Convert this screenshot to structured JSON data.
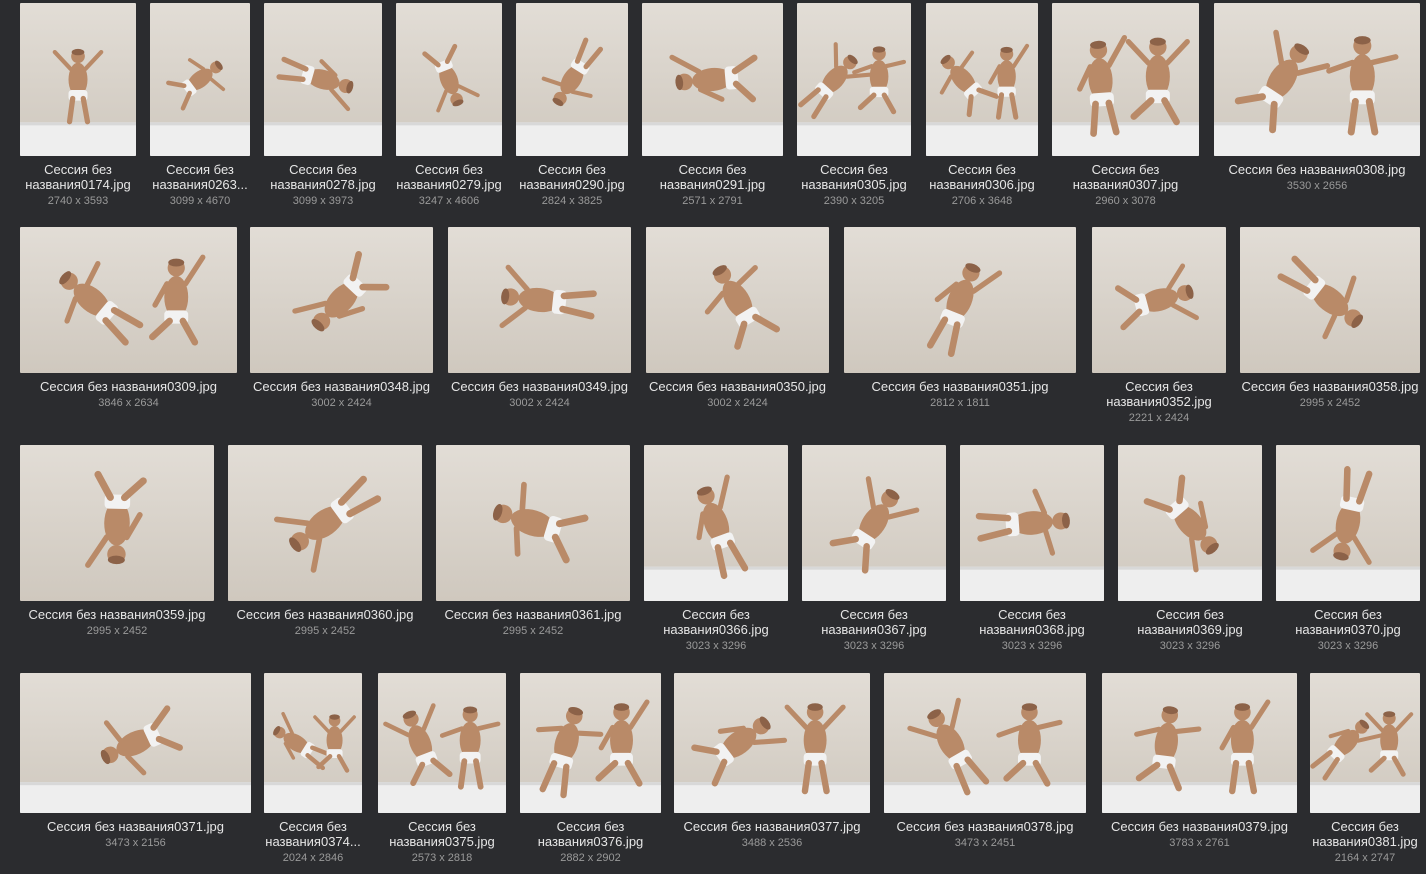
{
  "gallery": {
    "items": [
      {
        "name": "Сессия без названия0174.jpg",
        "dims": "2740 x 3593"
      },
      {
        "name": "Сессия без названия0263...",
        "dims": "3099 x 4670"
      },
      {
        "name": "Сессия без названия0278.jpg",
        "dims": "3099 x 3973"
      },
      {
        "name": "Сессия без названия0279.jpg",
        "dims": "3247 x 4606"
      },
      {
        "name": "Сессия без названия0290.jpg",
        "dims": "2824 x 3825"
      },
      {
        "name": "Сессия без названия0291.jpg",
        "dims": "2571 x 2791"
      },
      {
        "name": "Сессия без названия0305.jpg",
        "dims": "2390 x 3205"
      },
      {
        "name": "Сессия без названия0306.jpg",
        "dims": "2706 x 3648"
      },
      {
        "name": "Сессия без названия0307.jpg",
        "dims": "2960 x 3078"
      },
      {
        "name": "Сессия без названия0308.jpg",
        "dims": "3530 x 2656"
      },
      {
        "name": "Сессия без названия0309.jpg",
        "dims": "3846 x 2634"
      },
      {
        "name": "Сессия без названия0348.jpg",
        "dims": "3002 x 2424"
      },
      {
        "name": "Сессия без названия0349.jpg",
        "dims": "3002 x 2424"
      },
      {
        "name": "Сессия без названия0350.jpg",
        "dims": "3002 x 2424"
      },
      {
        "name": "Сессия без названия0351.jpg",
        "dims": "2812 x 1811"
      },
      {
        "name": "Сессия без названия0352.jpg",
        "dims": "2221 x 2424"
      },
      {
        "name": "Сессия без названия0358.jpg",
        "dims": "2995 x 2452"
      },
      {
        "name": "Сессия без названия0359.jpg",
        "dims": "2995 x 2452"
      },
      {
        "name": "Сессия без названия0360.jpg",
        "dims": "2995 x 2452"
      },
      {
        "name": "Сессия без названия0361.jpg",
        "dims": "2995 x 2452"
      },
      {
        "name": "Сессия без названия0366.jpg",
        "dims": "3023 x 3296"
      },
      {
        "name": "Сессия без названия0367.jpg",
        "dims": "3023 x 3296"
      },
      {
        "name": "Сессия без названия0368.jpg",
        "dims": "3023 x 3296"
      },
      {
        "name": "Сессия без названия0369.jpg",
        "dims": "3023 x 3296"
      },
      {
        "name": "Сессия без названия0370.jpg",
        "dims": "3023 x 3296"
      },
      {
        "name": "Сессия без названия0371.jpg",
        "dims": "3473 x 2156"
      },
      {
        "name": "Сессия без названия0374...",
        "dims": "2024 x 2846"
      },
      {
        "name": "Сессия без названия0375.jpg",
        "dims": "2573 x 2818"
      },
      {
        "name": "Сессия без названия0376.jpg",
        "dims": "2882 x 2902"
      },
      {
        "name": "Сессия без названия0377.jpg",
        "dims": "3488 x 2536"
      },
      {
        "name": "Сессия без названия0378.jpg",
        "dims": "3473 x 2451"
      },
      {
        "name": "Сессия без названия0379.jpg",
        "dims": "3783 x 2761"
      },
      {
        "name": "Сессия без названия0381.jpg",
        "dims": "2164 x 2747"
      }
    ]
  }
}
